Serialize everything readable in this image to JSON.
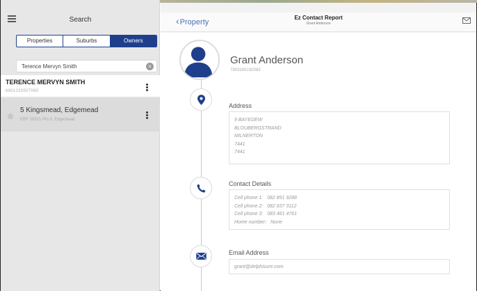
{
  "left_panel": {
    "title": "Search",
    "segments": [
      {
        "label": "Properties",
        "active": false
      },
      {
        "label": "Suburbs",
        "active": false
      },
      {
        "label": "Owners",
        "active": true
      }
    ],
    "search": {
      "value": "Terence Mervyn Smith"
    },
    "owner": {
      "name": "TERENCE MERVYN SMITH",
      "id": "6901230507080"
    },
    "property": {
      "address": "5 Kingsmead, Edgemead",
      "sub": "ERF 16321 Ptn 0, Edgemead"
    }
  },
  "nav": {
    "back_label": "Property",
    "title": "Ez Contact Report",
    "subtitle": "Grant Anderson"
  },
  "profile": {
    "name": "Grant Anderson",
    "id": "7903185192083"
  },
  "sections": {
    "address": {
      "label": "Address",
      "lines": [
        "9 BAYEDEW",
        "BLOUBERGSTRAND",
        "MILNERTON",
        "7441",
        "7441"
      ]
    },
    "contact": {
      "label": "Contact Details",
      "lines": [
        "Cell phone 1:   082 851 9288",
        "Cell phone 2:   082 637 3112",
        "Cell phone 3:   083 461 4761",
        "Home number:   None"
      ]
    },
    "email": {
      "label": "Email Address",
      "value": "grant@delphisure.com"
    }
  },
  "icons": {
    "menu": "menu-icon",
    "clear": "clear-icon",
    "home": "home-icon",
    "mail": "mail-icon",
    "location": "location-pin-icon",
    "phone": "phone-icon",
    "envelope": "envelope-icon",
    "avatar": "user-avatar-icon"
  },
  "colors": {
    "accent": "#1f3f8c",
    "link": "#4a71b8"
  }
}
